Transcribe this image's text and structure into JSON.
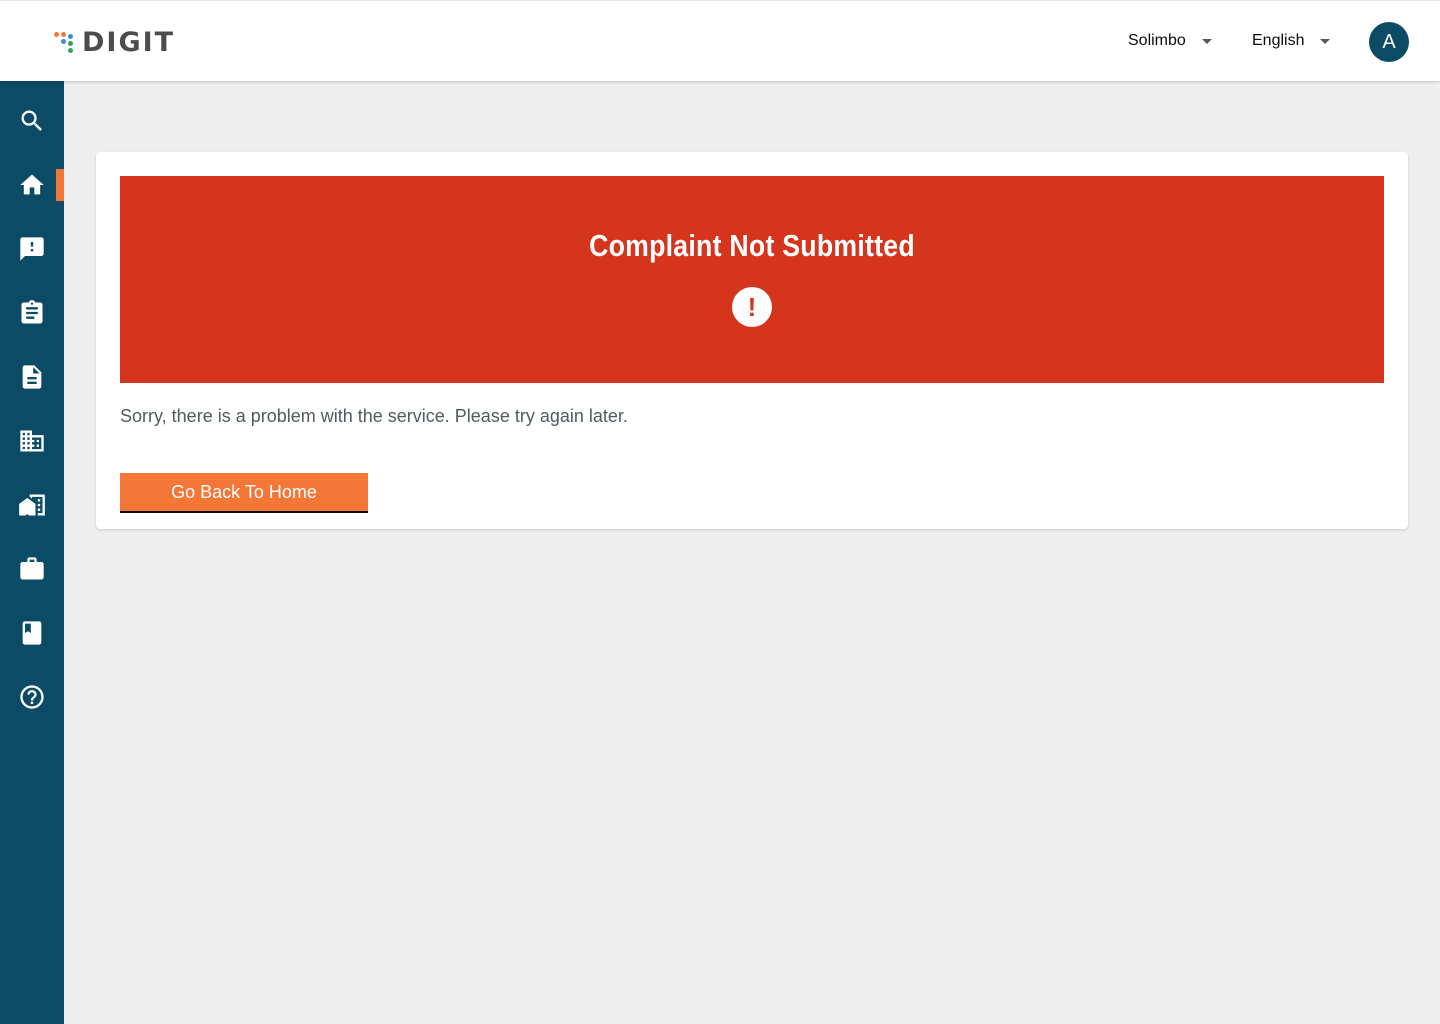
{
  "header": {
    "logo_text": "DIGIT",
    "city_selector": "Solimbo",
    "language_selector": "English",
    "avatar_initial": "A"
  },
  "sidebar": {
    "items": [
      {
        "icon": "search-icon"
      },
      {
        "icon": "home-icon",
        "active": true
      },
      {
        "icon": "complaint-icon"
      },
      {
        "icon": "clipboard-icon"
      },
      {
        "icon": "document-icon"
      },
      {
        "icon": "building-icon"
      },
      {
        "icon": "property-icon"
      },
      {
        "icon": "briefcase-icon"
      },
      {
        "icon": "book-icon"
      },
      {
        "icon": "help-icon"
      }
    ]
  },
  "main": {
    "banner_title": "Complaint Not Submitted",
    "banner_icon": "exclamation-icon",
    "message": "Sorry, there is a problem with the service. Please try again later.",
    "home_button": "Go Back To Home"
  },
  "colors": {
    "sidebar": "#0b4b66",
    "accent": "#f47738",
    "error": "#d4351c",
    "background": "#eeeeee"
  }
}
